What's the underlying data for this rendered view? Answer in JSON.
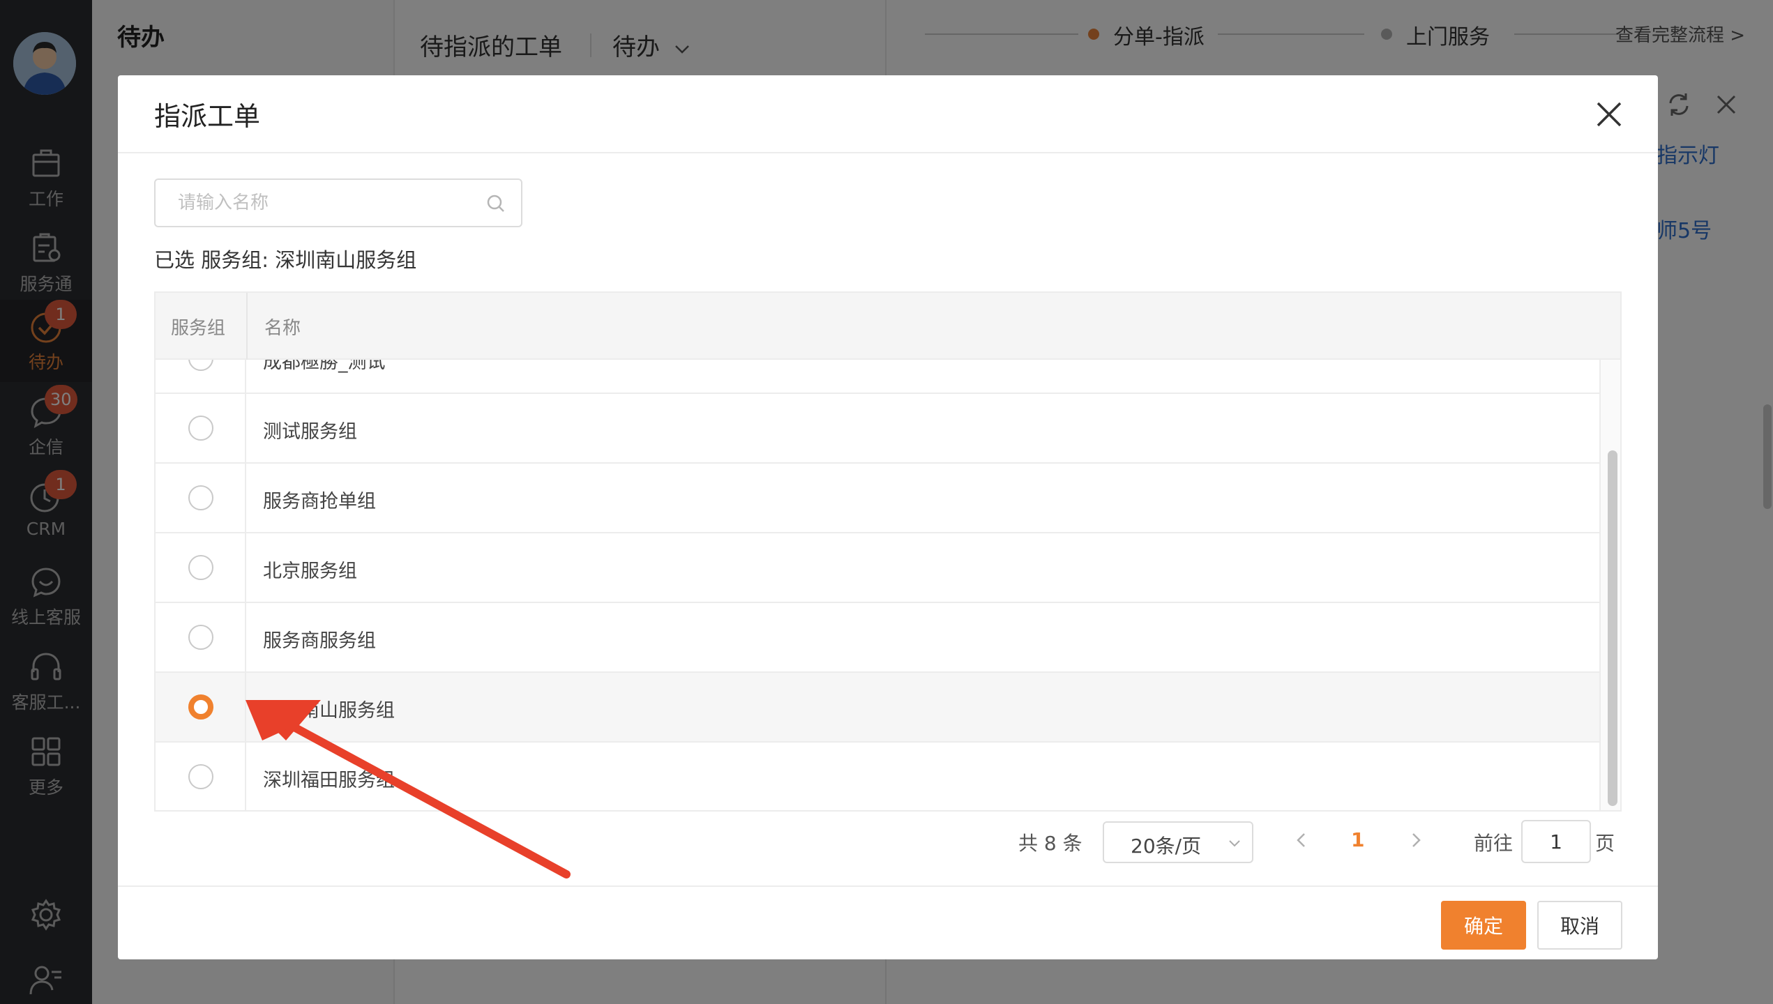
{
  "sidebar": {
    "items": [
      {
        "label": "工作",
        "icon": "briefcase-icon"
      },
      {
        "label": "服务通",
        "icon": "service-clipboard-icon"
      },
      {
        "label": "待办",
        "icon": "check-circle-icon",
        "badge": "1",
        "active": true
      },
      {
        "label": "企信",
        "icon": "chat-bubble-icon",
        "badge": "30"
      },
      {
        "label": "CRM",
        "icon": "clock-icon",
        "badge": "1"
      },
      {
        "label": "线上客服",
        "icon": "smile-chat-icon"
      },
      {
        "label": "客服工...",
        "icon": "headset-icon"
      },
      {
        "label": "更多",
        "icon": "grid-icon"
      }
    ],
    "bottom_icons": [
      "gear-icon",
      "user-list-icon"
    ]
  },
  "background": {
    "list_title": "待办",
    "tab_title": "待指派的工单",
    "tab_filter": "待办",
    "steps": [
      "分单-指派",
      "上门服务"
    ],
    "flow_link": "查看完整流程 >",
    "side_text_1": "指示灯",
    "side_text_2": "师5号"
  },
  "modal": {
    "title": "指派工单",
    "search_placeholder": "请输入名称",
    "selected_text": "已选 服务组: 深圳南山服务组",
    "columns": [
      "服务组",
      "名称"
    ],
    "rows": [
      {
        "name": "成都極勝_测试",
        "selected": false
      },
      {
        "name": "测试服务组",
        "selected": false
      },
      {
        "name": "服务商抢单组",
        "selected": false
      },
      {
        "name": "北京服务组",
        "selected": false
      },
      {
        "name": "服务商服务组",
        "selected": false
      },
      {
        "name": "深圳南山服务组",
        "selected": true
      },
      {
        "name": "深圳福田服务组",
        "selected": false
      }
    ],
    "pagination": {
      "total": "共 8 条",
      "page_size": "20条/页",
      "current": "1",
      "goto_label": "前往",
      "goto_value": "1",
      "page_unit": "页"
    },
    "ok_label": "确定",
    "cancel_label": "取消"
  },
  "colors": {
    "accent": "#f0812e",
    "sidebar_bg": "#2b2c30",
    "badge": "#e35a3d",
    "annotation_arrow": "#e8402a"
  }
}
